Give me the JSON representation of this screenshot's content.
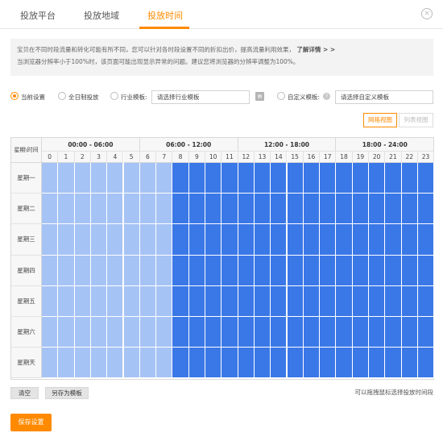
{
  "tabs": [
    {
      "label": "投放平台",
      "active": false
    },
    {
      "label": "投放地域",
      "active": false
    },
    {
      "label": "投放时间",
      "active": true
    }
  ],
  "close_icon": "×",
  "notice": {
    "line1": "宝贝在不同时段流量和转化可能有所不同，您可以针对各时段设置不同的折扣出价，提高流量利用效果，",
    "more": "了解详情 > >",
    "line2": "当浏览器分辨率小于100%时，该页面可能出现显示异常的问题。建议您将浏览器的分辨率调整为100%。"
  },
  "options": {
    "current": "当前设置",
    "all_day": "全日制投放",
    "industry": "行业模板:",
    "industry_placeholder": "请选择行业模板",
    "custom": "自定义模板:",
    "custom_placeholder": "请选择自定义模板",
    "selected": "current"
  },
  "view": {
    "grid": "网格视图",
    "list": "列表视图",
    "selected": "grid"
  },
  "grid": {
    "corner_label": "星期\\时间",
    "groups": [
      "00:00 - 06:00",
      "06:00 - 12:00",
      "12:00 - 18:00",
      "18:00 - 24:00"
    ],
    "hours": [
      "0",
      "1",
      "2",
      "3",
      "4",
      "5",
      "6",
      "7",
      "8",
      "9",
      "10",
      "11",
      "12",
      "13",
      "14",
      "15",
      "16",
      "17",
      "18",
      "19",
      "20",
      "21",
      "22",
      "23"
    ],
    "days": [
      "星期一",
      "星期二",
      "星期三",
      "星期四",
      "星期五",
      "星期六",
      "星期天"
    ],
    "light_hours_end": 8,
    "colors": {
      "light": "#a6c3f5",
      "dark": "#3b78e7"
    }
  },
  "buttons": {
    "clear": "清空",
    "save_template": "另存为模板",
    "save": "保存设置"
  },
  "hint": "可以拖拽鼠标选择投放时间段",
  "colors": {
    "accent": "#ff8a00"
  }
}
